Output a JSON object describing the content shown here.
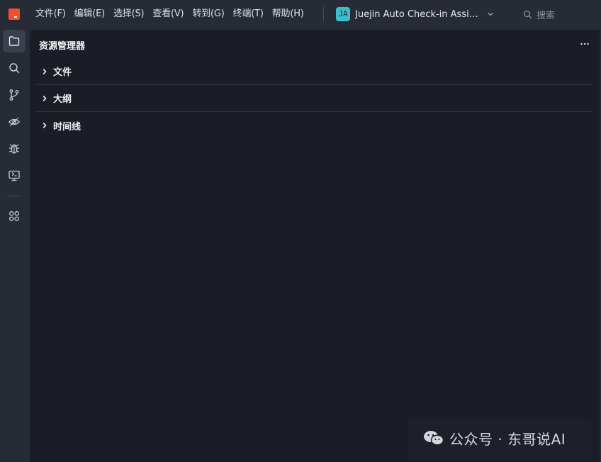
{
  "menu": {
    "items": [
      "文件(F)",
      "编辑(E)",
      "选择(S)",
      "查看(V)",
      "转到(G)",
      "终端(T)",
      "帮助(H)"
    ]
  },
  "project": {
    "badge": "JA",
    "name": "Juejin Auto Check-in Assistant",
    "icon": "chevron-down-icon"
  },
  "search": {
    "label": "搜索",
    "icon": "search-icon"
  },
  "activity_bar": {
    "items": [
      {
        "icon": "files-icon",
        "active": true
      },
      {
        "icon": "search-icon",
        "active": false
      },
      {
        "icon": "source-control-icon",
        "active": false
      },
      {
        "icon": "preview-eye-icon",
        "active": false
      },
      {
        "icon": "debug-bug-icon",
        "active": false
      },
      {
        "icon": "remote-monitor-icon",
        "active": false
      },
      {
        "icon": "extensions-grid-icon",
        "active": false
      }
    ]
  },
  "explorer": {
    "title": "资源管理器",
    "more_icon": "more-dots-icon",
    "sections": [
      "文件",
      "大纲",
      "时间线"
    ]
  },
  "watermark": {
    "text": "公众号 · 东哥说AI",
    "icon": "wechat-icon"
  },
  "colors": {
    "logo": "#f0502e",
    "badge": "#3bbfc9",
    "panel_bg": "#1a1d26",
    "chrome_bg": "#262b36",
    "active_item_bg": "#3a404d"
  }
}
